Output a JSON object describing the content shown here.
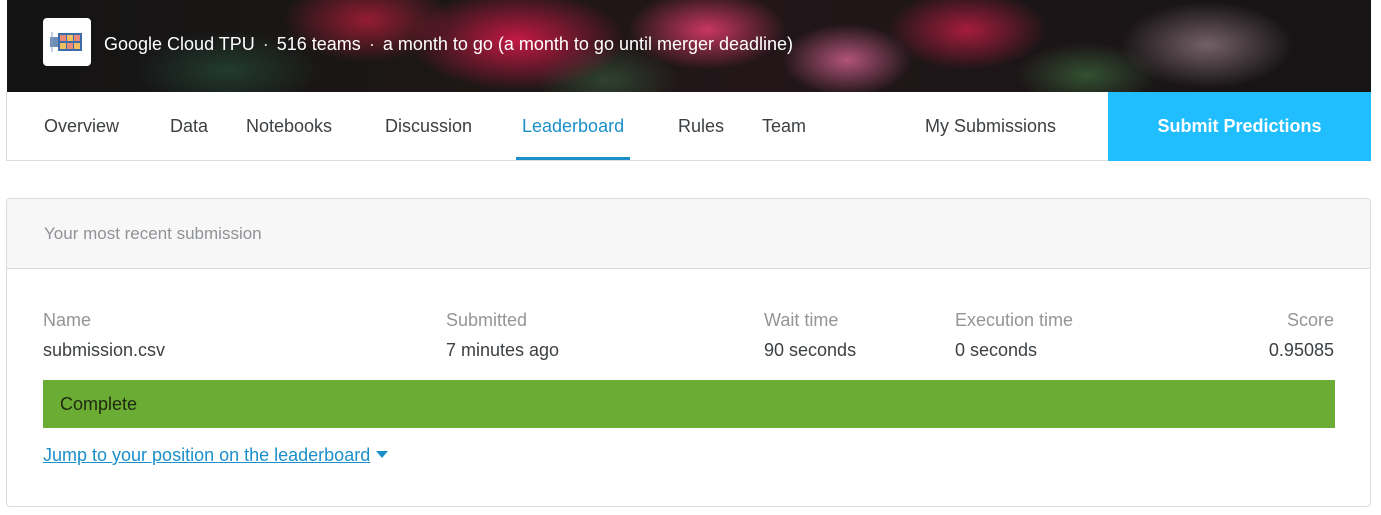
{
  "competition": {
    "name": "Google Cloud TPU",
    "teams": "516 teams",
    "deadline": "a month to go (a month to go until merger deadline)",
    "separator": "·"
  },
  "nav": {
    "tabs": [
      {
        "label": "Overview"
      },
      {
        "label": "Data"
      },
      {
        "label": "Notebooks"
      },
      {
        "label": "Discussion"
      },
      {
        "label": "Leaderboard",
        "active": true
      },
      {
        "label": "Rules"
      },
      {
        "label": "Team"
      }
    ],
    "my_submissions": "My Submissions",
    "submit_predictions": "Submit Predictions"
  },
  "submission": {
    "header": "Your most recent submission",
    "columns": {
      "name": {
        "label": "Name",
        "value": "submission.csv"
      },
      "submitted": {
        "label": "Submitted",
        "value": "7 minutes ago"
      },
      "wait_time": {
        "label": "Wait time",
        "value": "90 seconds"
      },
      "execution_time": {
        "label": "Execution time",
        "value": "0 seconds"
      },
      "score": {
        "label": "Score",
        "value": "0.95085"
      }
    },
    "status": "Complete",
    "jump_link": "Jump to your position on the leaderboard"
  },
  "colors": {
    "accent": "#1a8fc9",
    "submit_button": "#20beff",
    "status_complete": "#6aac34"
  },
  "icons": {
    "competition_logo": "tpu-chip-icon",
    "jump_caret": "caret-down-icon"
  }
}
